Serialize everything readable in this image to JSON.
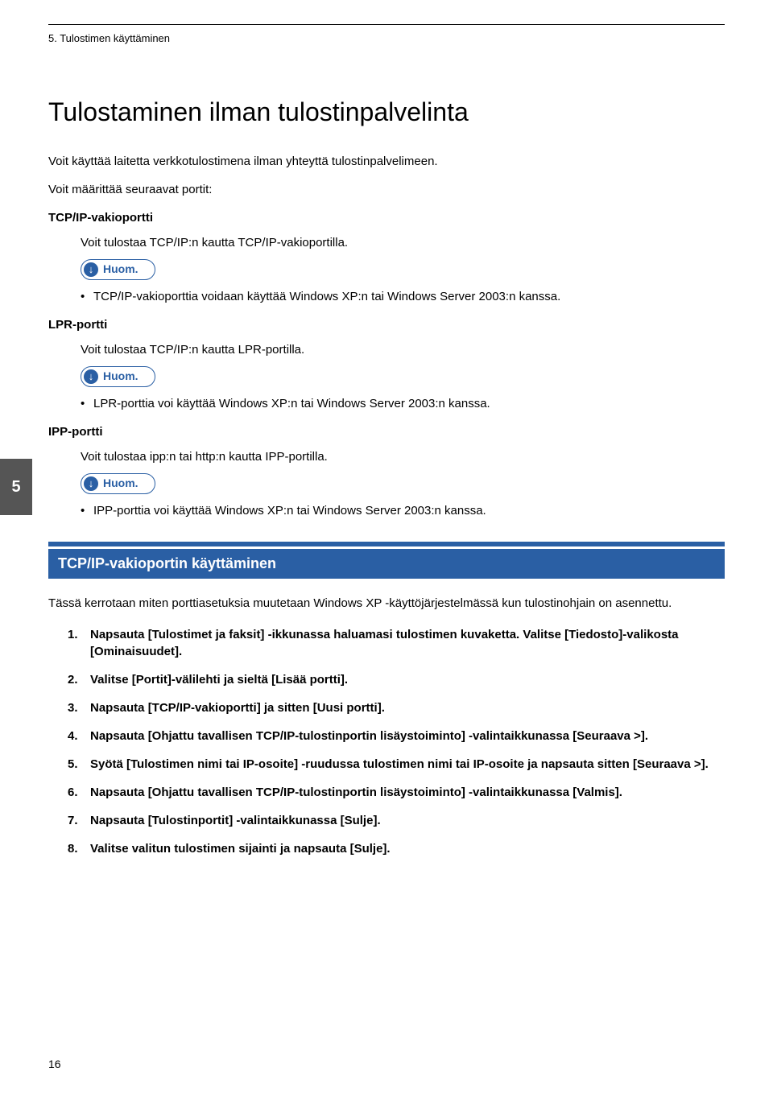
{
  "header": {
    "chapter": "5. Tulostimen käyttäminen"
  },
  "sideTab": "5",
  "title": "Tulostaminen ilman tulostinpalvelinta",
  "intro": "Voit käyttää laitetta verkkotulostimena ilman yhteyttä tulostinpalvelimeen.",
  "subIntro": "Voit määrittää seuraavat portit:",
  "noteLabel": "Huom.",
  "ports": {
    "tcpip": {
      "heading": "TCP/IP-vakioportti",
      "desc": "Voit tulostaa TCP/IP:n kautta TCP/IP-vakioportilla.",
      "note": "TCP/IP-vakioporttia voidaan käyttää Windows XP:n tai Windows Server 2003:n kanssa."
    },
    "lpr": {
      "heading": "LPR-portti",
      "desc": "Voit tulostaa TCP/IP:n kautta LPR-portilla.",
      "note": "LPR-porttia voi käyttää Windows XP:n tai Windows Server 2003:n kanssa."
    },
    "ipp": {
      "heading": "IPP-portti",
      "desc": "Voit tulostaa ipp:n tai http:n kautta IPP-portilla.",
      "note": "IPP-porttia voi käyttää Windows XP:n tai Windows Server 2003:n kanssa."
    }
  },
  "section": {
    "heading": "TCP/IP-vakioportin käyttäminen",
    "intro": "Tässä kerrotaan miten porttiasetuksia muutetaan Windows XP -käyttöjärjestelmässä kun tulostinohjain on asennettu.",
    "steps": [
      "Napsauta [Tulostimet ja faksit] -ikkunassa haluamasi tulostimen kuvaketta. Valitse [Tiedosto]-valikosta [Ominaisuudet].",
      "Valitse [Portit]-välilehti ja sieltä [Lisää portti].",
      "Napsauta [TCP/IP-vakioportti] ja sitten [Uusi portti].",
      "Napsauta [Ohjattu tavallisen TCP/IP-tulostinportin lisäystoiminto] -valintaikkunassa [Seuraava >].",
      "Syötä [Tulostimen nimi tai IP-osoite] -ruudussa tulostimen nimi tai IP-osoite ja napsauta sitten [Seuraava >].",
      "Napsauta [Ohjattu tavallisen TCP/IP-tulostinportin lisäystoiminto] -valintaikkunassa [Valmis].",
      "Napsauta [Tulostinportit] -valintaikkunassa [Sulje].",
      "Valitse valitun tulostimen sijainti ja napsauta [Sulje]."
    ]
  },
  "pageNumber": "16"
}
